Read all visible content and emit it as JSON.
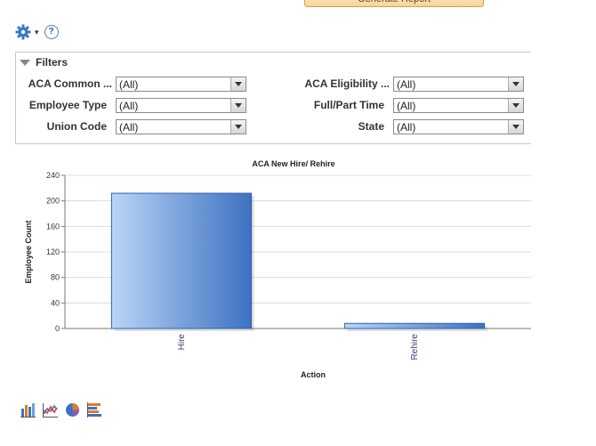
{
  "header": {
    "generate_report_label": "Generate Report"
  },
  "toolbar": {
    "caret_glyph": "▾",
    "help_glyph": "?"
  },
  "filters": {
    "title": "Filters",
    "left": [
      {
        "label": "ACA Common ...",
        "value": "(All)"
      },
      {
        "label": "Employee Type",
        "value": "(All)"
      },
      {
        "label": "Union Code",
        "value": "(All)"
      }
    ],
    "right": [
      {
        "label": "ACA Eligibility ...",
        "value": "(All)"
      },
      {
        "label": "Full/Part Time",
        "value": "(All)"
      },
      {
        "label": "State",
        "value": "(All)"
      }
    ]
  },
  "chart_data": {
    "type": "bar",
    "title": "ACA New Hire/ Rehire",
    "xlabel": "Action",
    "ylabel": "Employee Count",
    "categories": [
      "Hire",
      "Rehire"
    ],
    "values": [
      212,
      8
    ],
    "ylim": [
      0,
      240
    ],
    "yticks": [
      0,
      40,
      80,
      120,
      160,
      200,
      240
    ],
    "grid": true,
    "colors": {
      "bar_light": "#b9d4f7",
      "bar_dark": "#3d72c0",
      "bar_edge": "#2f62b0"
    }
  },
  "chart_type_icons": [
    "bar-chart-icon",
    "line-chart-icon",
    "pie-chart-icon",
    "horizontal-bar-chart-icon"
  ]
}
